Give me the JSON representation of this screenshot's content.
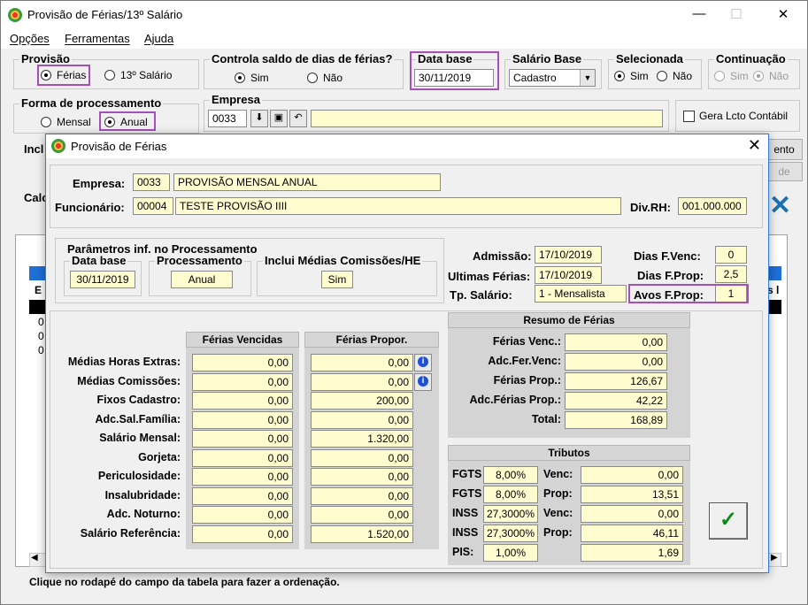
{
  "main": {
    "title": "Provisão de Férias/13º Salário",
    "controls": {
      "minimize": "—",
      "maximize": "☐",
      "close": "✕"
    },
    "menu": [
      "Opções",
      "Ferramentas",
      "Ajuda"
    ],
    "provisao": {
      "label": "Provisão",
      "opt1": "Férias",
      "opt2": "13º Salário"
    },
    "controla": {
      "label": "Controla saldo de dias de férias?",
      "sim": "Sim",
      "nao": "Não"
    },
    "data_base": {
      "label": "Data base",
      "value": "30/11/2019"
    },
    "salario_base": {
      "label": "Salário Base",
      "value": "Cadastro"
    },
    "selecionada": {
      "label": "Selecionada",
      "sim": "Sim",
      "nao": "Não"
    },
    "continuacao": {
      "label": "Continuação",
      "sim": "Sim",
      "nao": "Não"
    },
    "forma": {
      "label": "Forma de processamento",
      "mensal": "Mensal",
      "anual": "Anual"
    },
    "empresa": {
      "label": "Empresa",
      "code": "0033",
      "name": ""
    },
    "gera_lcto": "Gera Lcto Contábil",
    "partial_incl": "Incl",
    "partial_calc": "Calc",
    "partial_ento": "ento",
    "partial_de": "de",
    "partial_row_E": "E",
    "partial_row_s": "s l",
    "partial_rows": [
      "0",
      "0",
      "0"
    ],
    "status": "Clique no rodapé do campo da tabela  para fazer a ordenação."
  },
  "dialog": {
    "title": "Provisão de Férias",
    "close": "✕",
    "empresa_label": "Empresa:",
    "empresa_code": "0033",
    "empresa_name": "PROVISÃO MENSAL ANUAL",
    "funcionario_label": "Funcionário:",
    "funcionario_code": "00004",
    "funcionario_name": "TESTE PROVISÃO IIII",
    "divrh_label": "Div.RH:",
    "divrh_value": "001.000.000",
    "parametros": {
      "label": "Parâmetros inf. no Processamento",
      "data_base_label": "Data base",
      "data_base_value": "30/11/2019",
      "processamento_label": "Processamento",
      "processamento_value": "Anual",
      "medias_label": "Inclui Médias Comissões/HE",
      "medias_value": "Sim"
    },
    "admissao_label": "Admissão:",
    "admissao_value": "17/10/2019",
    "ultimas_label": "Ultimas Férias:",
    "ultimas_value": "17/10/2019",
    "tp_salario_label": "Tp. Salário:",
    "tp_salario_value": "1 - Mensalista",
    "dias_venc_label": "Dias F.Venc:",
    "dias_venc_value": "0",
    "dias_prop_label": "Dias F.Prop:",
    "dias_prop_value": "2,5",
    "avos_label": "Avos F.Prop:",
    "avos_value": "1",
    "col_vencidas": "Férias Vencidas",
    "col_propor": "Férias Propor.",
    "rows": [
      {
        "label": "Médias Horas Extras:",
        "venc": "0,00",
        "prop": "0,00"
      },
      {
        "label": "Médias Comissões:",
        "venc": "0,00",
        "prop": "0,00"
      },
      {
        "label": "Fixos Cadastro:",
        "venc": "0,00",
        "prop": "200,00"
      },
      {
        "label": "Adc.Sal.Família:",
        "venc": "0,00",
        "prop": "0,00"
      },
      {
        "label": "Salário Mensal:",
        "venc": "0,00",
        "prop": "1.320,00"
      },
      {
        "label": "Gorjeta:",
        "venc": "0,00",
        "prop": "0,00"
      },
      {
        "label": "Periculosidade:",
        "venc": "0,00",
        "prop": "0,00"
      },
      {
        "label": "Insalubridade:",
        "venc": "0,00",
        "prop": "0,00"
      },
      {
        "label": "Adc. Noturno:",
        "venc": "0,00",
        "prop": "0,00"
      },
      {
        "label": "Salário Referência:",
        "venc": "0,00",
        "prop": "1.520,00"
      }
    ],
    "resumo": {
      "title": "Resumo de Férias",
      "items": [
        {
          "label": "Férias Venc.:",
          "value": "0,00"
        },
        {
          "label": "Adc.Fer.Venc:",
          "value": "0,00"
        },
        {
          "label": "Férias Prop.:",
          "value": "126,67"
        },
        {
          "label": "Adc.Férias Prop.:",
          "value": "42,22"
        },
        {
          "label": "Total:",
          "value": "168,89"
        }
      ]
    },
    "tributos": {
      "title": "Tributos",
      "rows": [
        {
          "name": "FGTS",
          "pct": "8,00%",
          "kind": "Venc:",
          "value": "0,00"
        },
        {
          "name": "FGTS",
          "pct": "8,00%",
          "kind": "Prop:",
          "value": "13,51"
        },
        {
          "name": "INSS",
          "pct": "27,3000%",
          "kind": "Venc:",
          "value": "0,00"
        },
        {
          "name": "INSS",
          "pct": "27,3000%",
          "kind": "Prop:",
          "value": "46,11"
        },
        {
          "name": "PIS:",
          "pct": "1,00%",
          "kind": "",
          "value": "1,69"
        }
      ]
    },
    "ok_icon": "✓"
  }
}
